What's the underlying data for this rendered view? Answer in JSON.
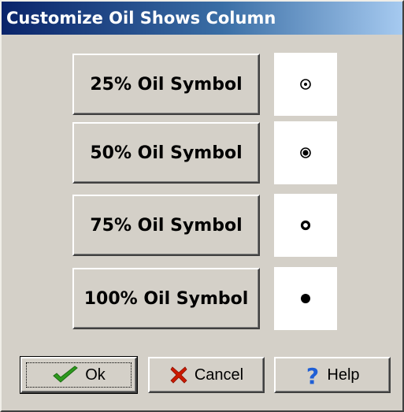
{
  "dialog": {
    "title": "Customize Oil Shows Column"
  },
  "symbols": [
    {
      "label": "25% Oil Symbol",
      "symbol_icon": "dot-in-ring-icon"
    },
    {
      "label": "50% Oil Symbol",
      "symbol_icon": "filled-dot-in-ring-icon"
    },
    {
      "label": "75% Oil Symbol",
      "symbol_icon": "thick-ring-icon"
    },
    {
      "label": "100% Oil Symbol",
      "symbol_icon": "solid-dot-icon"
    }
  ],
  "buttons": {
    "ok": {
      "label": "Ok",
      "icon": "checkmark-icon",
      "icon_color": "#2e9a1e"
    },
    "cancel": {
      "label": "Cancel",
      "icon": "x-icon",
      "icon_color": "#cc1a00"
    },
    "help": {
      "label": "Help",
      "icon": "question-icon",
      "icon_color": "#1f5fd6"
    }
  },
  "colors": {
    "dialog_background": "#d4d0c8",
    "title_gradient_start": "#0a246a",
    "title_gradient_end": "#a6caf0",
    "swatch_background": "#ffffff"
  }
}
